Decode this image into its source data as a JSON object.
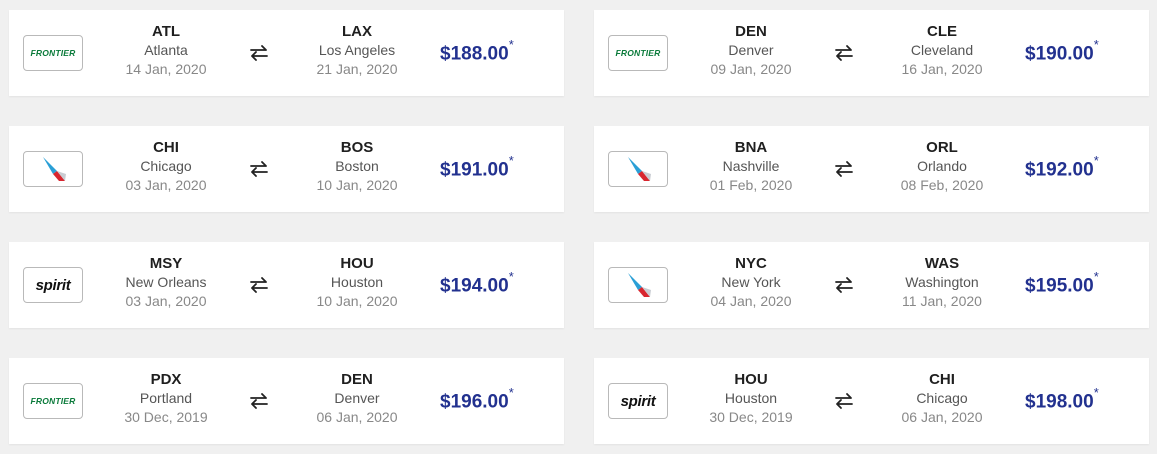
{
  "colors": {
    "price": "#22318f",
    "frontier_green": "#0a7a3a",
    "background": "#f0f0f0",
    "card": "#ffffff"
  },
  "deals": [
    {
      "airline_logo": "frontier",
      "logo_text": "FRONTIER",
      "from": {
        "code": "ATL",
        "city": "Atlanta",
        "date": "14 Jan, 2020"
      },
      "to": {
        "code": "LAX",
        "city": "Los Angeles",
        "date": "21 Jan, 2020"
      },
      "price": "$188.00",
      "price_mark": "*"
    },
    {
      "airline_logo": "frontier",
      "logo_text": "FRONTIER",
      "from": {
        "code": "DEN",
        "city": "Denver",
        "date": "09 Jan, 2020"
      },
      "to": {
        "code": "CLE",
        "city": "Cleveland",
        "date": "16 Jan, 2020"
      },
      "price": "$190.00",
      "price_mark": "*"
    },
    {
      "airline_logo": "american",
      "logo_text": "",
      "from": {
        "code": "CHI",
        "city": "Chicago",
        "date": "03 Jan, 2020"
      },
      "to": {
        "code": "BOS",
        "city": "Boston",
        "date": "10 Jan, 2020"
      },
      "price": "$191.00",
      "price_mark": "*"
    },
    {
      "airline_logo": "american",
      "logo_text": "",
      "from": {
        "code": "BNA",
        "city": "Nashville",
        "date": "01 Feb, 2020"
      },
      "to": {
        "code": "ORL",
        "city": "Orlando",
        "date": "08 Feb, 2020"
      },
      "price": "$192.00",
      "price_mark": "*"
    },
    {
      "airline_logo": "spirit",
      "logo_text": "spirit",
      "from": {
        "code": "MSY",
        "city": "New Orleans",
        "date": "03 Jan, 2020"
      },
      "to": {
        "code": "HOU",
        "city": "Houston",
        "date": "10 Jan, 2020"
      },
      "price": "$194.00",
      "price_mark": "*"
    },
    {
      "airline_logo": "american",
      "logo_text": "",
      "from": {
        "code": "NYC",
        "city": "New York",
        "date": "04 Jan, 2020"
      },
      "to": {
        "code": "WAS",
        "city": "Washington",
        "date": "11 Jan, 2020"
      },
      "price": "$195.00",
      "price_mark": "*"
    },
    {
      "airline_logo": "frontier",
      "logo_text": "FRONTIER",
      "from": {
        "code": "PDX",
        "city": "Portland",
        "date": "30 Dec, 2019"
      },
      "to": {
        "code": "DEN",
        "city": "Denver",
        "date": "06 Jan, 2020"
      },
      "price": "$196.00",
      "price_mark": "*"
    },
    {
      "airline_logo": "spirit",
      "logo_text": "spirit",
      "from": {
        "code": "HOU",
        "city": "Houston",
        "date": "30 Dec, 2019"
      },
      "to": {
        "code": "CHI",
        "city": "Chicago",
        "date": "06 Jan, 2020"
      },
      "price": "$198.00",
      "price_mark": "*"
    }
  ]
}
